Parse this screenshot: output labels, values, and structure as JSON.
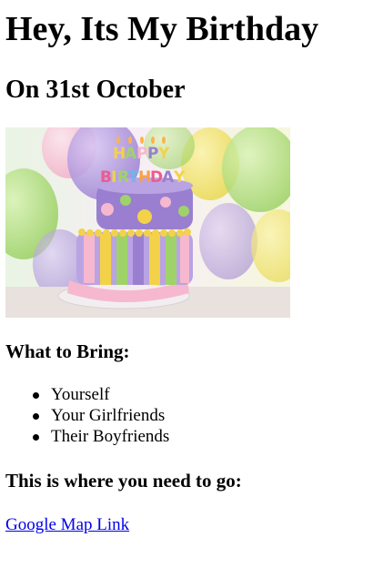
{
  "header": {
    "title": "Hey, Its My Birthday",
    "subtitle": "On 31st October"
  },
  "image": {
    "icon": "birthday-cake-photo",
    "topper_text": "HAPPY BIRTHDAY",
    "colors": {
      "purple": "#9a7fd0",
      "lilac": "#b9a3e3",
      "yellow": "#f3d24a",
      "green": "#9fd36a",
      "pink": "#f6b8cf",
      "plate": "#f2eef0"
    }
  },
  "bring": {
    "heading": "What to Bring:",
    "items": [
      "Yourself",
      "Your Girlfriends",
      "Their Boyfriends"
    ]
  },
  "location": {
    "heading": "This is where you need to go:",
    "link_label": "Google Map Link",
    "link_color": "#0000ee"
  }
}
